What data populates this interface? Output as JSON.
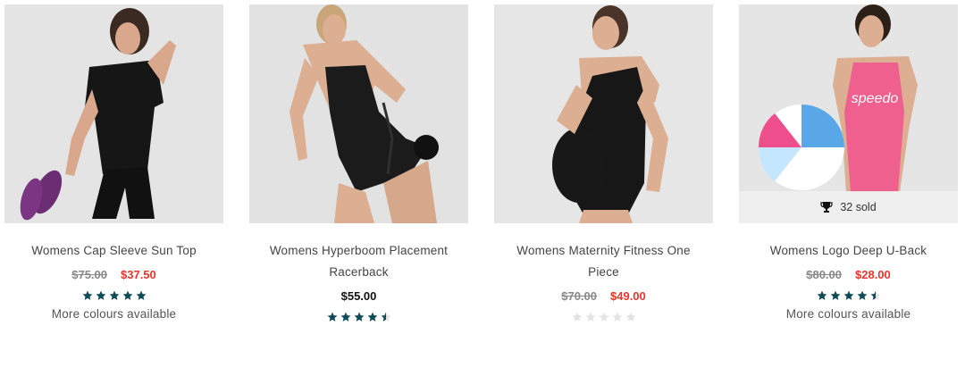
{
  "colors": {
    "sale": "#e8352e",
    "star_filled": "#0d4b57",
    "star_empty": "#e3e3e3"
  },
  "products": [
    {
      "name": "Womens Cap Sleeve Sun Top",
      "was_price": "$75.00",
      "price": "$37.50",
      "rating": 5,
      "more_colours": "More colours available"
    },
    {
      "name": "Womens Hyperboom Placement Racerback",
      "price": "$55.00",
      "rating": 4.5
    },
    {
      "name": "Womens Maternity Fitness One Piece",
      "was_price": "$70.00",
      "price": "$49.00",
      "rating": 0
    },
    {
      "name": "Womens Logo Deep U-Back",
      "was_price": "$80.00",
      "price": "$28.00",
      "rating": 4.5,
      "sold_badge": "32 sold",
      "more_colours": "More colours available"
    }
  ]
}
